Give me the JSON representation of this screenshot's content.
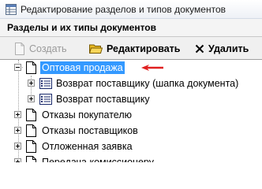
{
  "window": {
    "title": "Редактирование разделов и типов документов",
    "title_icon": "grid-window-icon"
  },
  "panel": {
    "header": "Разделы и их типы документов"
  },
  "toolbar": {
    "create_label": "Создать",
    "create_enabled": false,
    "edit_label": "Редактировать",
    "delete_label": "Удалить"
  },
  "tree": {
    "items": [
      {
        "label": "Оптовая продажа",
        "state": "expanded",
        "selected": true,
        "level": 0,
        "icon": "document-icon"
      },
      {
        "label": "Возврат поставщику (шапка документа)",
        "state": "collapsed",
        "level": 1,
        "icon": "list-icon"
      },
      {
        "label": "Возврат поставщику",
        "state": "collapsed",
        "level": 1,
        "icon": "list-icon"
      },
      {
        "label": "Отказы покупателю",
        "state": "collapsed",
        "level": 0,
        "icon": "document-icon"
      },
      {
        "label": "Отказы поставщиков",
        "state": "collapsed",
        "level": 0,
        "icon": "document-icon"
      },
      {
        "label": "Отложенная заявка",
        "state": "collapsed",
        "level": 0,
        "icon": "document-icon"
      },
      {
        "label": "Передача комиссионеру",
        "state": "collapsed",
        "level": 0,
        "icon": "document-icon"
      }
    ]
  },
  "colors": {
    "selection": "#3399ff",
    "arrow": "#e02020",
    "toolbar_bg": "#f0f0f0"
  }
}
